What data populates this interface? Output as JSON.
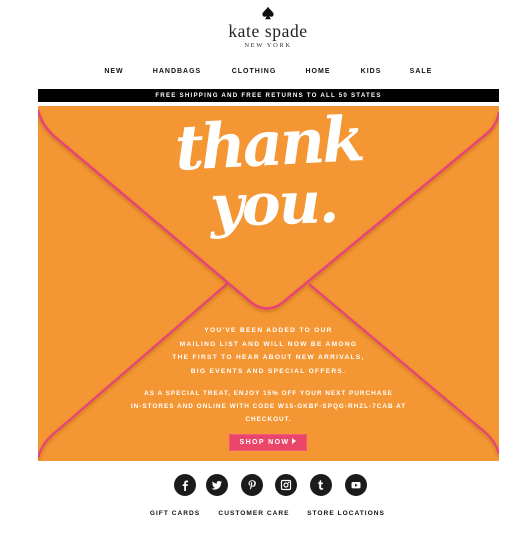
{
  "header": {
    "brand": "kate spade",
    "subtitle": "NEW YORK",
    "logo_icon": "spade-icon"
  },
  "nav": {
    "items": [
      {
        "label": "NEW"
      },
      {
        "label": "HANDBAGS"
      },
      {
        "label": "CLOTHING"
      },
      {
        "label": "HOME"
      },
      {
        "label": "KIDS"
      },
      {
        "label": "SALE"
      }
    ]
  },
  "promo_bar": {
    "text": "FREE SHIPPING AND FREE RETURNS TO ALL 50 STATES"
  },
  "hero": {
    "headline_line1": "thank",
    "headline_line2": "you.",
    "message_lines": [
      "YOU'VE BEEN ADDED TO OUR",
      "MAILING LIST AND WILL NOW BE AMONG",
      "THE FIRST TO HEAR ABOUT NEW ARRIVALS,",
      "BIG EVENTS AND SPECIAL OFFERS."
    ],
    "offer_lines": [
      "AS A SPECIAL TREAT, ENJOY 15% OFF YOUR NEXT PURCHASE",
      "IN-STORES AND ONLINE WITH CODE W15-GKBF-SPQG-RHZL-7CAB AT",
      "CHECKOUT."
    ],
    "cta_label": "SHOP NOW",
    "cta_icon": "play-arrow-icon",
    "colors": {
      "background": "#f39633",
      "envelope_line": "#e8437a",
      "cta": "#e9466a"
    }
  },
  "social": {
    "icons": [
      {
        "name": "facebook-icon",
        "glyph": "f"
      },
      {
        "name": "twitter-icon",
        "glyph": "t-bird"
      },
      {
        "name": "pinterest-icon",
        "glyph": "p"
      },
      {
        "name": "instagram-icon",
        "glyph": "cam"
      },
      {
        "name": "tumblr-icon",
        "glyph": "t"
      },
      {
        "name": "youtube-icon",
        "glyph": "play"
      }
    ]
  },
  "footer": {
    "links": [
      {
        "label": "GIFT CARDS"
      },
      {
        "label": "CUSTOMER CARE"
      },
      {
        "label": "STORE LOCATIONS"
      }
    ]
  }
}
